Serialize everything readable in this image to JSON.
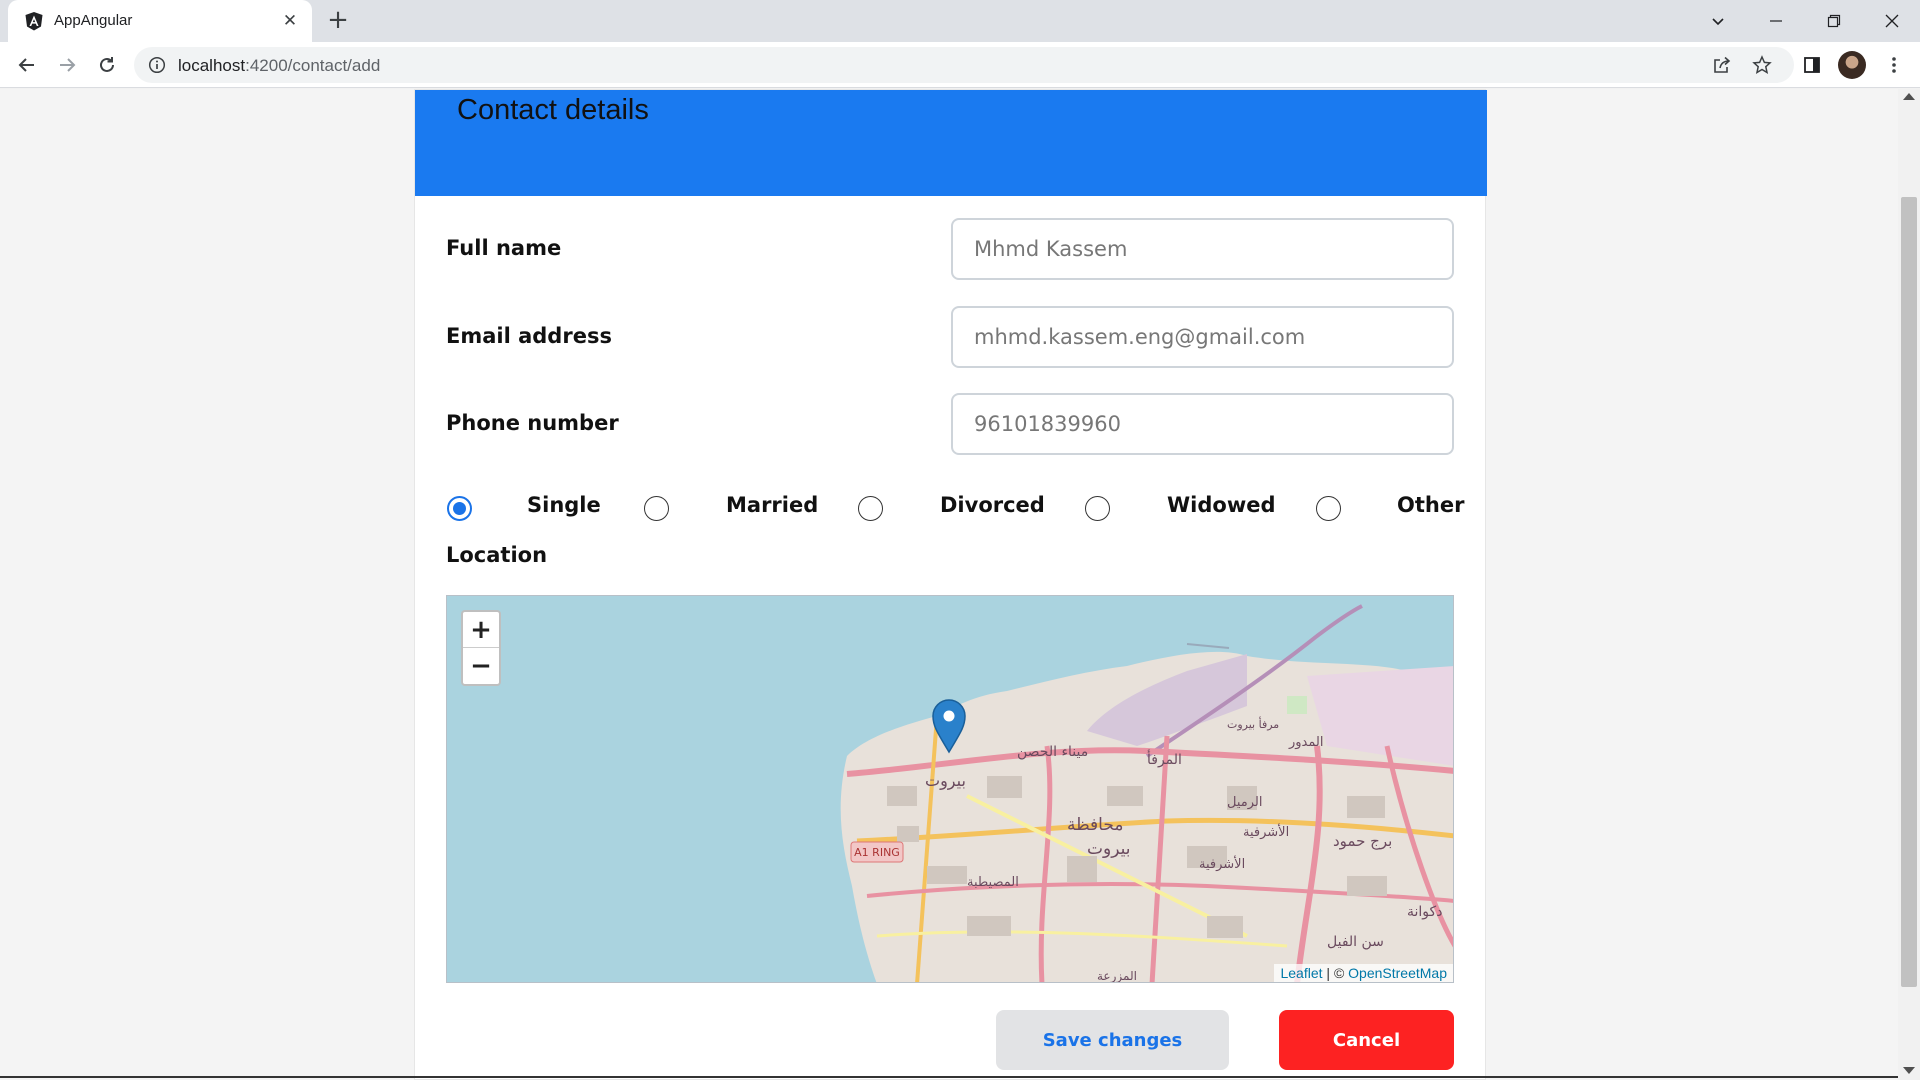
{
  "browser": {
    "tab_title": "AppAngular",
    "tab_close": "✕",
    "new_tab": "+",
    "url_host": "localhost",
    "url_path": ":4200/contact/add"
  },
  "card": {
    "title": "Contact details"
  },
  "form": {
    "full_name": {
      "label": "Full name",
      "value": "Mhmd Kassem"
    },
    "email": {
      "label": "Email address",
      "value": "mhmd.kassem.eng@gmail.com"
    },
    "phone": {
      "label": "Phone number",
      "value": "96101839960"
    },
    "status_options": [
      "Single",
      "Married",
      "Divorced",
      "Widowed",
      "Other"
    ],
    "status_selected": "Single",
    "location_label": "Location"
  },
  "map": {
    "zoom_in": "+",
    "zoom_out": "−",
    "attribution_leaflet": "Leaflet",
    "attribution_sep": " | © ",
    "attribution_osm": "OpenStreetMap",
    "labels": {
      "a1_ring": "A1 RING",
      "beirut": "بيروت",
      "mina_hosn": "ميناء الحصن",
      "marfa": "المرفأ",
      "mdawar": "المدور",
      "rmeil": "الرميل",
      "ashrafieh": "الأشرفية",
      "ashrafieh2": "الأشرفية",
      "muhafaza": "محافظة",
      "beirut2": "بيروت",
      "mousaytbeh": "المصيطبة",
      "bourj_hammoud": "برج حمود",
      "sin_el_fil": "سن الفيل",
      "dekwaneh": "دكوانة",
      "marfa_beirut": "مرفأ بيروت",
      "mazraa": "المزرعة"
    }
  },
  "buttons": {
    "save": "Save changes",
    "cancel": "Cancel"
  },
  "colors": {
    "header_blue": "#1a7af0",
    "cancel_red": "#fd2222",
    "save_text_blue": "#1a73e8",
    "radio_blue": "#1a73e8"
  }
}
